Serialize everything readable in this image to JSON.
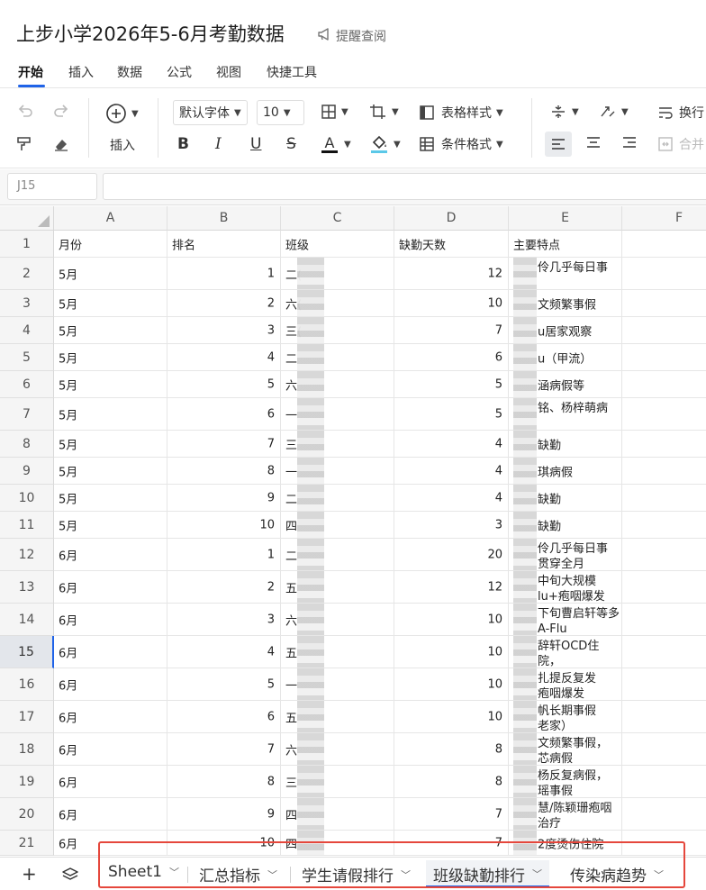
{
  "title": "上步小学2026年5-6月考勤数据",
  "remind_label": "提醒查阅",
  "menu": [
    "开始",
    "插入",
    "数据",
    "公式",
    "视图",
    "快捷工具"
  ],
  "toolbar": {
    "insert_label": "插入",
    "font": "默认字体",
    "font_size": "10",
    "table_style": "表格样式",
    "cond_format": "条件格式",
    "wrap": "换行",
    "merge": "合并",
    "text_color": "#e2001a",
    "fill_color": "#5bc8e8"
  },
  "name_box": "J15",
  "columns": [
    "A",
    "B",
    "C",
    "D",
    "E",
    "F"
  ],
  "rows": [
    {
      "n": "1",
      "a": "月份",
      "b": "排名",
      "c": "班级",
      "d": "缺勤天数",
      "e": "主要特点",
      "header": true
    },
    {
      "n": "2",
      "a": "5月",
      "b": "1",
      "c": "二(",
      "d": "12",
      "e": "伶几乎每日事"
    },
    {
      "n": "3",
      "a": "5月",
      "b": "2",
      "c": "六(",
      "d": "10",
      "e": "文频繁事假"
    },
    {
      "n": "4",
      "a": "5月",
      "b": "3",
      "c": "三(",
      "d": "7",
      "e": "u居家观察"
    },
    {
      "n": "5",
      "a": "5月",
      "b": "4",
      "c": "二",
      "d": "6",
      "e": "u（甲流）"
    },
    {
      "n": "6",
      "a": "5月",
      "b": "5",
      "c": "六",
      "d": "5",
      "e": "涵病假等"
    },
    {
      "n": "7",
      "a": "5月",
      "b": "6",
      "c": "一",
      "d": "5",
      "e": "铭、杨梓萌病"
    },
    {
      "n": "8",
      "a": "5月",
      "b": "7",
      "c": "三",
      "d": "4",
      "e": "缺勤"
    },
    {
      "n": "9",
      "a": "5月",
      "b": "8",
      "c": "一",
      "d": "4",
      "e": "琪病假"
    },
    {
      "n": "10",
      "a": "5月",
      "b": "9",
      "c": "二",
      "d": "4",
      "e": "缺勤"
    },
    {
      "n": "11",
      "a": "5月",
      "b": "10",
      "c": "四",
      "d": "3",
      "e": "缺勤"
    },
    {
      "n": "12",
      "a": "6月",
      "b": "1",
      "c": "二",
      "d": "20",
      "e": "伶几乎每日事\n贯穿全月"
    },
    {
      "n": "13",
      "a": "6月",
      "b": "2",
      "c": "五",
      "d": "12",
      "e": "中旬大规模\nlu+疱咽爆发"
    },
    {
      "n": "14",
      "a": "6月",
      "b": "3",
      "c": "六",
      "d": "10",
      "e": "下旬曹启轩等多\nA-Flu"
    },
    {
      "n": "15",
      "a": "6月",
      "b": "4",
      "c": "五",
      "d": "10",
      "e": "辞轩OCD住院，\n文B-Flu"
    },
    {
      "n": "16",
      "a": "6月",
      "b": "5",
      "c": "一",
      "d": "10",
      "e": "扎提反复发\n疱咽爆发"
    },
    {
      "n": "17",
      "a": "6月",
      "b": "6",
      "c": "五",
      "d": "10",
      "e": "帆长期事假\n老家）"
    },
    {
      "n": "18",
      "a": "6月",
      "b": "7",
      "c": "六",
      "d": "8",
      "e": "文频繁事假，\n芯病假"
    },
    {
      "n": "19",
      "a": "6月",
      "b": "8",
      "c": "三",
      "d": "8",
      "e": "杨反复病假，\n瑶事假"
    },
    {
      "n": "20",
      "a": "6月",
      "b": "9",
      "c": "四",
      "d": "7",
      "e": "慧/陈颖珊疱咽\n治疗"
    },
    {
      "n": "21",
      "a": "6月",
      "b": "10",
      "c": "四",
      "d": "7",
      "e": "2度烫伤住院"
    }
  ],
  "sheet_tabs": [
    "Sheet1",
    "汇总指标",
    "学生请假排行",
    "班级缺勤排行",
    "传染病趋势"
  ],
  "active_tab": "班级缺勤排行"
}
